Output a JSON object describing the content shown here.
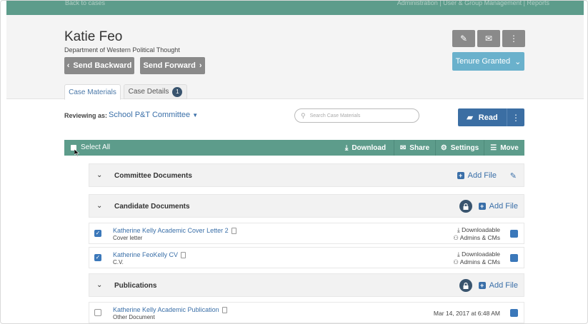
{
  "topbar": {
    "back": "Back to cases",
    "nav": "Administration  |  User & Group Management  |  Reports"
  },
  "candidate": {
    "name": "Katie Feo",
    "department": "Department of Western Political Thought"
  },
  "buttons": {
    "send_backward": "Send Backward",
    "send_forward": "Send Forward",
    "tenure": "Tenure Granted",
    "read": "Read"
  },
  "tabs": [
    {
      "label": "Case Materials"
    },
    {
      "label": "Case Details",
      "badge": "1"
    }
  ],
  "reviewing": {
    "label": "Reviewing as:",
    "value": "School P&T Committee"
  },
  "search": {
    "placeholder": "Search Case Materials"
  },
  "toolbar": {
    "select_all": "Select All",
    "download": "Download",
    "share": "Share",
    "settings": "Settings",
    "move": "Move"
  },
  "sections": [
    {
      "title": "Committee Documents",
      "add": "Add File"
    },
    {
      "title": "Candidate Documents",
      "add": "Add File"
    },
    {
      "title": "Publications",
      "add": "Add File"
    }
  ],
  "files": [
    {
      "title": "Katherine Kelly Academic Cover Letter 2",
      "type": "Cover letter",
      "downloadable": "Downloadable",
      "access": "Admins & CMs",
      "checked": true
    },
    {
      "title": "Katherine FeoKelly CV",
      "type": "C.V.",
      "downloadable": "Downloadable",
      "access": "Admins & CMs",
      "checked": true
    },
    {
      "title": "Katherine Kelly Academic Publication",
      "type": "Other Document",
      "date": "Mar 14, 2017 at 6:48 AM",
      "checked": false
    }
  ],
  "colors": {
    "teal": "#5d9c8b",
    "blue": "#3b6ea3",
    "tenure": "#6ab1cc",
    "gray": "#8a8a8a"
  }
}
